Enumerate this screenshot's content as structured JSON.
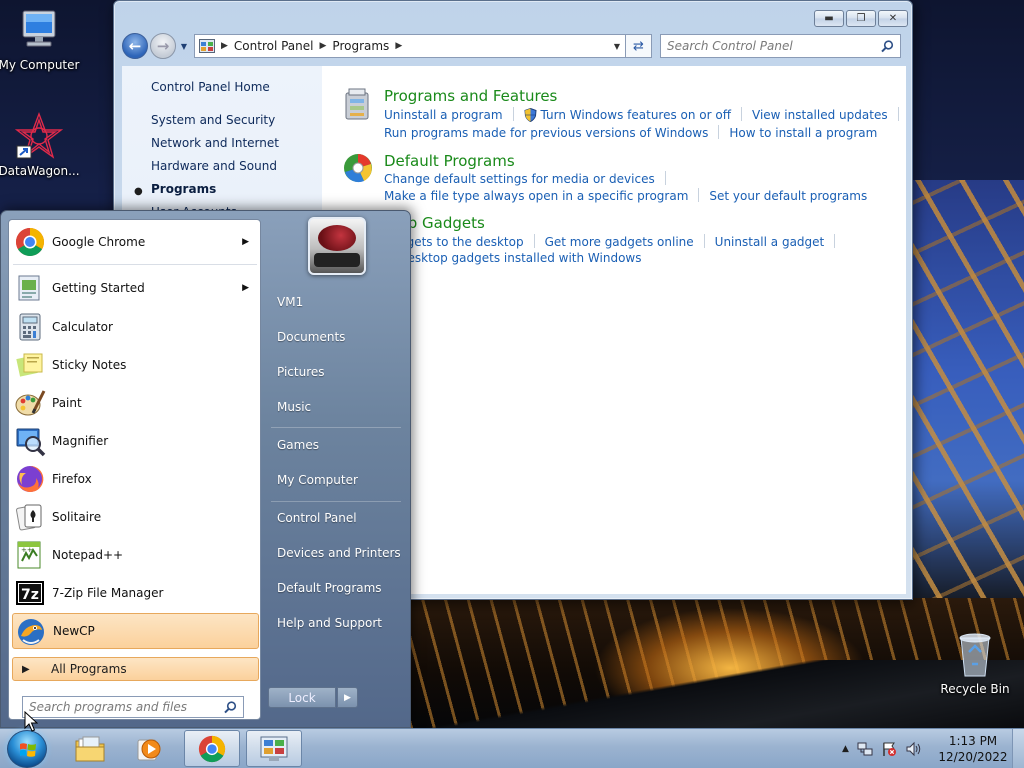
{
  "desktop": {
    "icons": [
      {
        "label": "My Computer"
      },
      {
        "label": "DataWagon..."
      },
      {
        "label": "Recycle Bin"
      }
    ]
  },
  "window": {
    "breadcrumbs": [
      "Control Panel",
      "Programs"
    ],
    "search_placeholder": "Search Control Panel",
    "sidebar": {
      "home": "Control Panel Home",
      "items": [
        "System and Security",
        "Network and Internet",
        "Hardware and Sound",
        "Programs",
        "User Accounts"
      ],
      "selected": "Programs"
    },
    "categories": [
      {
        "title": "Programs and Features",
        "links": [
          [
            "Uninstall a program",
            "Turn Windows features on or off",
            "View installed updates"
          ],
          [
            "Run programs made for previous versions of Windows",
            "How to install a program"
          ]
        ]
      },
      {
        "title": "Default Programs",
        "links": [
          [
            "Change default settings for media or devices"
          ],
          [
            "Make a file type always open in a specific program",
            "Set your default programs"
          ]
        ]
      },
      {
        "title": "ktop Gadgets",
        "links": [
          [
            "gadgets to the desktop",
            "Get more gadgets online",
            "Uninstall a gadget"
          ],
          [
            "re desktop gadgets installed with Windows"
          ]
        ]
      }
    ]
  },
  "start_menu": {
    "programs": [
      {
        "label": "Google Chrome",
        "icon": "chrome-icon",
        "submenu": true
      },
      {
        "label": "Getting Started",
        "icon": "getting-started-icon",
        "submenu": true
      },
      {
        "label": "Calculator",
        "icon": "calculator-icon",
        "submenu": false
      },
      {
        "label": "Sticky Notes",
        "icon": "sticky-notes-icon",
        "submenu": false
      },
      {
        "label": "Paint",
        "icon": "paint-icon",
        "submenu": false
      },
      {
        "label": "Magnifier",
        "icon": "magnifier-icon",
        "submenu": false
      },
      {
        "label": "Firefox",
        "icon": "firefox-icon",
        "submenu": false
      },
      {
        "label": "Solitaire",
        "icon": "solitaire-icon",
        "submenu": false
      },
      {
        "label": "Notepad++",
        "icon": "notepadpp-icon",
        "submenu": false
      },
      {
        "label": "7-Zip File Manager",
        "icon": "7zip-icon",
        "submenu": false
      },
      {
        "label": "NewCP",
        "icon": "newcp-icon",
        "submenu": false,
        "highlighted": true
      }
    ],
    "all_programs": "All Programs",
    "search_placeholder": "Search programs and files",
    "right_links": [
      "VM1",
      "Documents",
      "Pictures",
      "Music",
      "Games",
      "My Computer",
      "Control Panel",
      "Devices and Printers",
      "Default Programs",
      "Help and Support"
    ],
    "lock_label": "Lock"
  },
  "taskbar": {
    "pinned": [
      "explorer-icon",
      "media-player-icon",
      "chrome-icon",
      "control-panel-icon"
    ],
    "time": "1:13 PM",
    "date": "12/20/2022"
  },
  "colors": {
    "link": "#1a5fb4",
    "category_title": "#1a8a1a",
    "highlight": "#fbd19c"
  }
}
